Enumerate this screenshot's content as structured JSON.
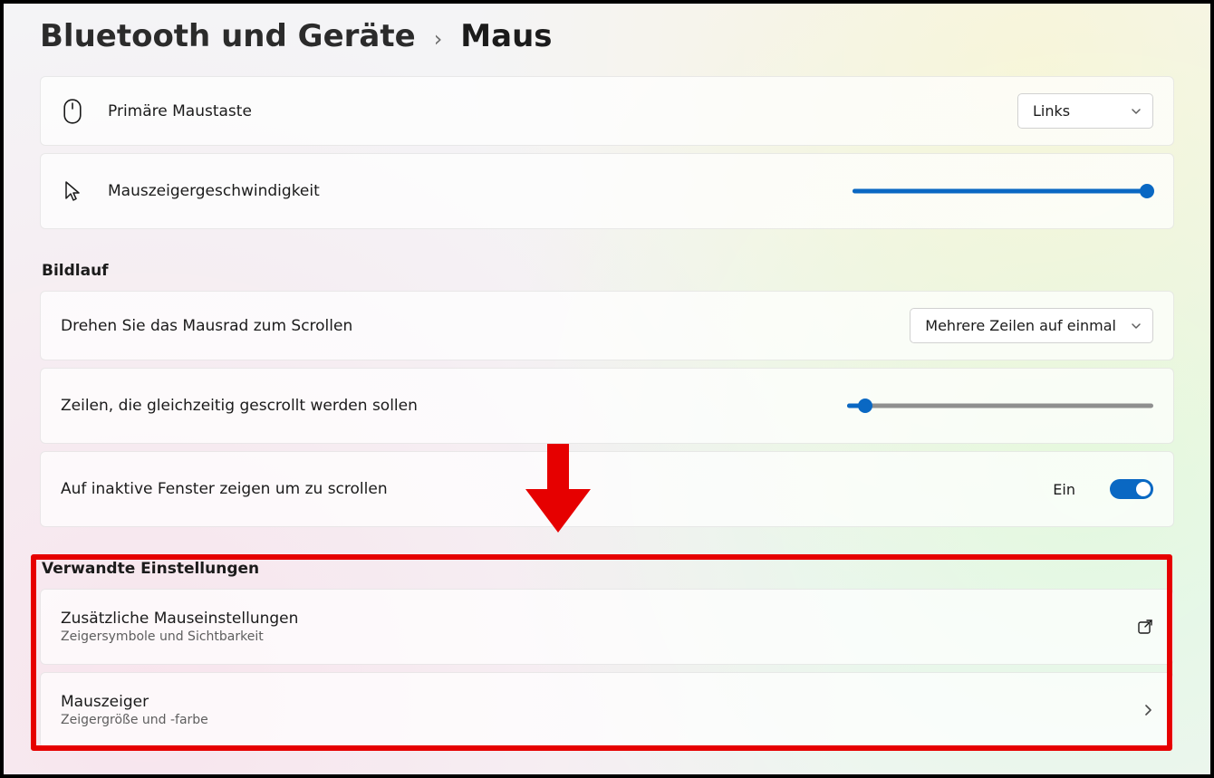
{
  "breadcrumb": {
    "parent": "Bluetooth und Geräte",
    "current": "Maus"
  },
  "primary_button": {
    "label": "Primäre Maustaste",
    "selected": "Links"
  },
  "pointer_speed": {
    "label": "Mauszeigergeschwindigkeit",
    "value_pct": 98
  },
  "scroll_section": {
    "title": "Bildlauf",
    "wheel": {
      "label": "Drehen Sie das Mausrad zum Scrollen",
      "selected": "Mehrere Zeilen auf einmal"
    },
    "lines": {
      "label": "Zeilen, die gleichzeitig gescrollt werden sollen",
      "value_pct": 6
    },
    "inactive": {
      "label": "Auf inaktive Fenster zeigen um zu scrollen",
      "state_label": "Ein",
      "state": true
    }
  },
  "related": {
    "title": "Verwandte Einstellungen",
    "items": [
      {
        "title": "Zusätzliche Mauseinstellungen",
        "sub": "Zeigersymbole und Sichtbarkeit",
        "action": "external"
      },
      {
        "title": "Mauszeiger",
        "sub": "Zeigergröße und -farbe",
        "action": "navigate"
      }
    ]
  },
  "colors": {
    "accent": "#0a68c3",
    "annotation": "#e60000"
  }
}
